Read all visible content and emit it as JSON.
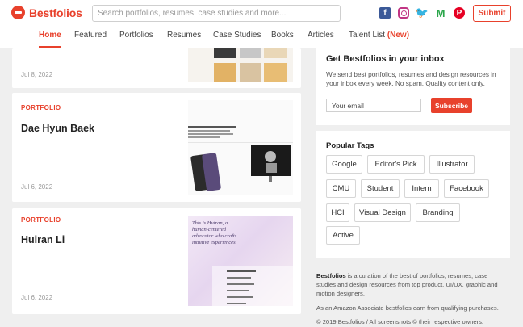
{
  "header": {
    "brand": "Bestfolios",
    "search_placeholder": "Search portfolios, resumes, case studies and more...",
    "social": [
      "facebook-icon",
      "instagram-icon",
      "twitter-icon",
      "medium-icon",
      "pinterest-icon"
    ],
    "submit_label": "Submit"
  },
  "nav": {
    "items": [
      "Home",
      "Featured",
      "Portfolios",
      "Resumes",
      "Case Studies",
      "Books",
      "Articles",
      "Talent List"
    ],
    "new_badge": "(New)",
    "active": "Home"
  },
  "cards": [
    {
      "date": "Jul 8, 2022"
    },
    {
      "category": "PORTFOLIO",
      "name": "Dae Hyun Baek",
      "date": "Jul 6, 2022"
    },
    {
      "category": "PORTFOLIO",
      "name": "Huiran Li",
      "date": "Jul 6, 2022",
      "preview_text": "This is Huiran, a human-centered advocator who crafts intuitive experiences."
    }
  ],
  "newsletter": {
    "title": "Get Bestfolios in your inbox",
    "description": "We send best portfolios, resumes and design resources in your inbox every week. No spam. Quality content only.",
    "email_placeholder": "Your email",
    "subscribe_label": "Subscribe"
  },
  "tags": {
    "title": "Popular Tags",
    "items": [
      "Google",
      "Editor's Pick",
      "Illustrator",
      "CMU",
      "Student",
      "Intern",
      "Facebook",
      "HCI",
      "Visual Design",
      "Branding",
      "Active"
    ]
  },
  "footer": {
    "brand": "Bestfolios",
    "about": " is a curation of the best of portfolios, resumes, case studies and design resources from top product, UI/UX, graphic and motion designers.",
    "affiliate": "As an Amazon Associate bestfolios earn from qualifying purchases.",
    "copyright": "© 2019 Bestfolios / All screenshots © their respective owners."
  },
  "colors": {
    "accent": "#e8412c",
    "background": "#efefef"
  }
}
